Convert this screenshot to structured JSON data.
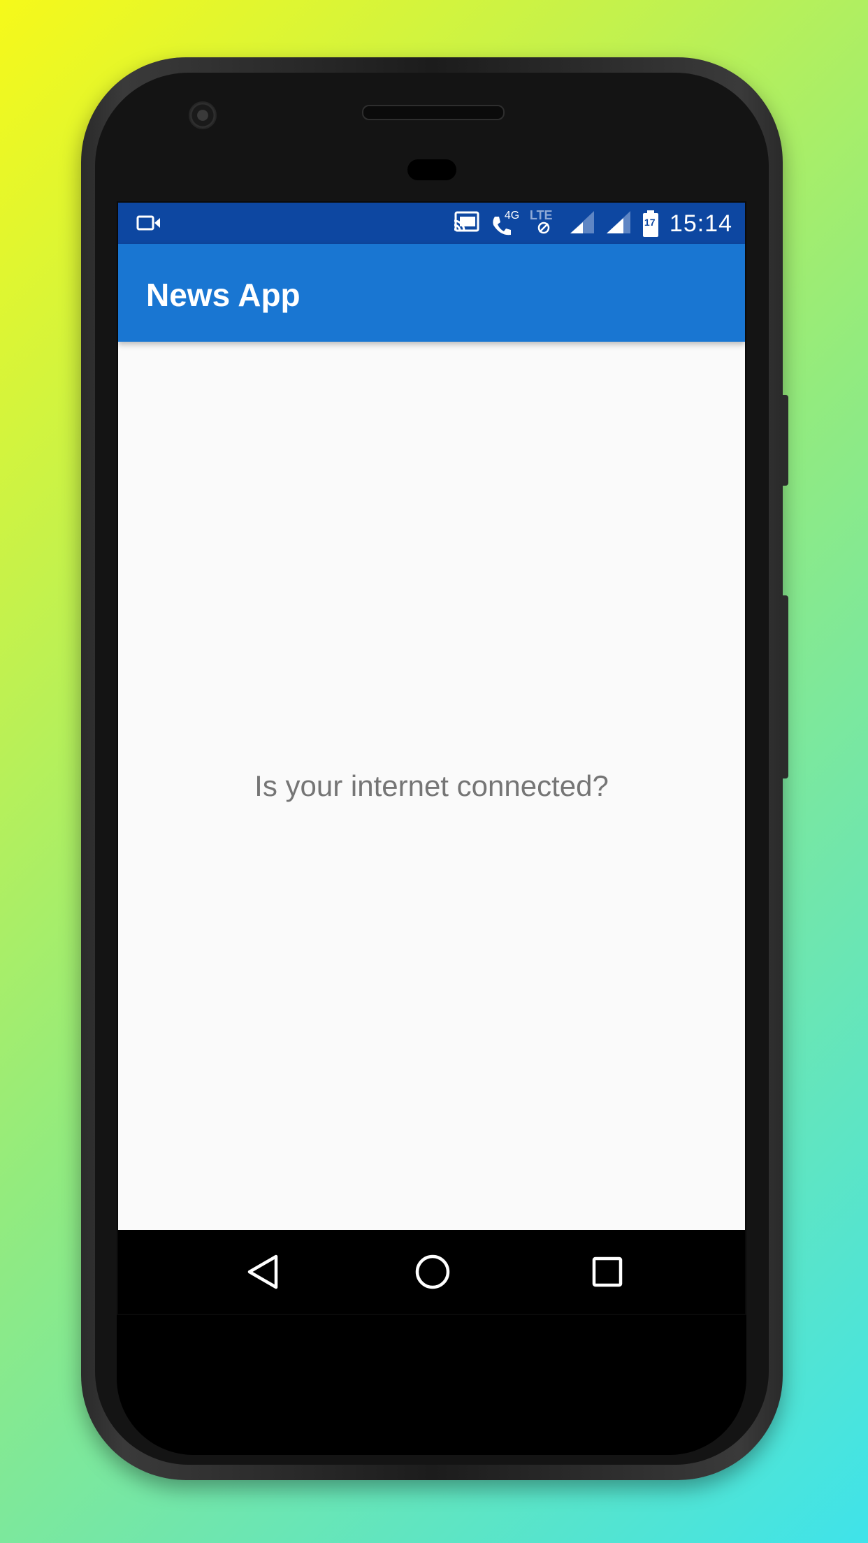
{
  "status_bar": {
    "time": "15:14",
    "network_label_4g": "4G",
    "network_label_lte": "LTE",
    "battery_level": "17",
    "icons": [
      "video-camera-icon",
      "cast-icon",
      "wifi-call-icon",
      "data-saver-icon",
      "signal-icon",
      "signal-icon",
      "battery-icon"
    ]
  },
  "app_bar": {
    "title": "News App",
    "color": "#1976d2",
    "status_color": "#0d47a1"
  },
  "content": {
    "message": "Is your internet connected?"
  },
  "nav_bar": {
    "icons": [
      "back-icon",
      "home-icon",
      "recents-icon"
    ]
  }
}
